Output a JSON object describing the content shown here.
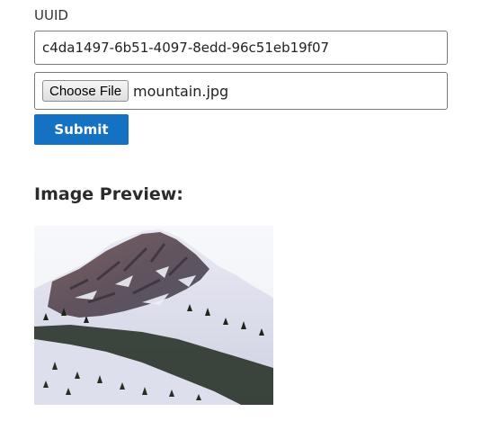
{
  "form": {
    "uuid_label": "UUID",
    "uuid_value": "c4da1497-6b51-4097-8edd-96c51eb19f07",
    "choose_file_label": "Choose File",
    "file_name": "mountain.jpg",
    "submit_label": "Submit"
  },
  "preview": {
    "heading": "Image Preview:",
    "image_subject": "snowy-mountain-photo"
  },
  "colors": {
    "accent": "#1572c3",
    "border": "#7a7a7a"
  }
}
